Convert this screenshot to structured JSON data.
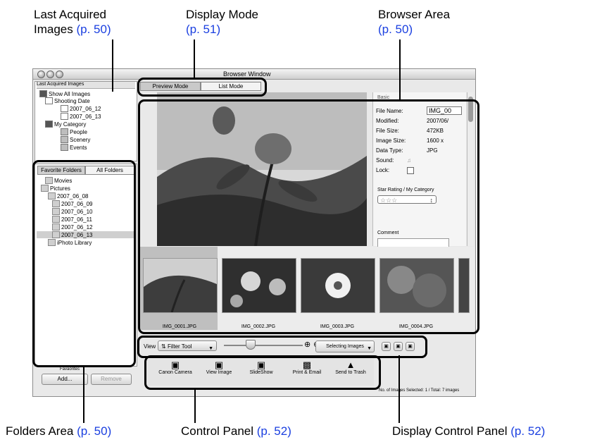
{
  "callouts": {
    "last_acquired": {
      "line1": "Last Acquired",
      "line2": "Images",
      "ref": "(p. 50)"
    },
    "display_mode": {
      "line1": "Display Mode",
      "ref": "(p. 51)"
    },
    "browser_area": {
      "line1": "Browser Area",
      "ref": "(p. 50)"
    },
    "folders_area": {
      "label": "Folders Area",
      "ref": "(p. 50)"
    },
    "control_panel": {
      "label": "Control Panel",
      "ref": "(p. 52)"
    },
    "display_control_panel": {
      "label": "Display Control Panel",
      "ref": "(p. 52)"
    }
  },
  "window": {
    "title": "Browser Window"
  },
  "last_acquired_panel": {
    "header": "Last Acquired Images",
    "items": [
      "Show All Images",
      "Shooting Date",
      "2007_06_12",
      "2007_06_13",
      "My Category",
      "People",
      "Scenery",
      "Events"
    ]
  },
  "folder_tabs": {
    "favorite": "Favorite Folders",
    "all": "All Folders"
  },
  "folders": [
    "Movies",
    "Pictures",
    "2007_06_08",
    "2007_06_09",
    "2007_06_10",
    "2007_06_11",
    "2007_06_12",
    "2007_06_13",
    "iPhoto Library"
  ],
  "favorites": {
    "label": "Favaorites",
    "add": "Add...",
    "remove": "Remove"
  },
  "mode_tabs": {
    "preview": "Preview Mode",
    "list": "List Mode"
  },
  "info": {
    "section": "Basic",
    "rows": [
      {
        "label": "File Name:",
        "value": "IMG_00"
      },
      {
        "label": "Modified:",
        "value": "2007/06/"
      },
      {
        "label": "File Size:",
        "value": "472KB"
      },
      {
        "label": "Image Size:",
        "value": "1600 x"
      },
      {
        "label": "Data Type:",
        "value": "JPG"
      },
      {
        "label": "Sound:",
        "value": ""
      },
      {
        "label": "Lock:",
        "value": ""
      }
    ],
    "star_section": "Star Rating / My Category",
    "comment_section": "Comment"
  },
  "thumbnails": [
    "IMG_0001.JPG",
    "IMG_0002.JPG",
    "IMG_0003.JPG",
    "IMG_0004.JPG"
  ],
  "toolbar": {
    "view": "View",
    "filter": "Filter Tool",
    "selecting": "Selecting Images"
  },
  "control_panel": {
    "buttons": [
      "Canon Camera",
      "View Image",
      "SlideShow",
      "Print & Email",
      "Send to Trash"
    ]
  },
  "status": "No. of Images Selected: 1 / Total: 7 images"
}
